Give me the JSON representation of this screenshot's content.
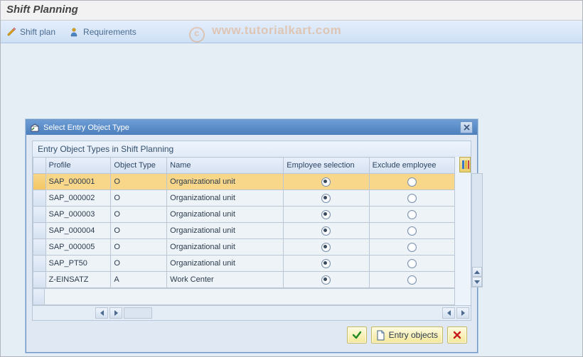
{
  "page": {
    "title": "Shift Planning",
    "watermark": "www.tutorialkart.com"
  },
  "toolbar": {
    "shift_plan": "Shift plan",
    "requirements": "Requirements"
  },
  "dialog": {
    "title": "Select Entry Object Type",
    "group_title": "Entry Object Types in Shift Planning",
    "columns": {
      "profile": "Profile",
      "object_type": "Object Type",
      "name": "Name",
      "employee_selection": "Employee selection",
      "exclude_employee": "Exclude employee"
    },
    "rows": [
      {
        "profile": "SAP_000001",
        "otype": "O",
        "name": "Organizational unit",
        "emp_sel": true,
        "excl": false,
        "selected": true
      },
      {
        "profile": "SAP_000002",
        "otype": "O",
        "name": "Organizational unit",
        "emp_sel": true,
        "excl": false,
        "selected": false
      },
      {
        "profile": "SAP_000003",
        "otype": "O",
        "name": "Organizational unit",
        "emp_sel": true,
        "excl": false,
        "selected": false
      },
      {
        "profile": "SAP_000004",
        "otype": "O",
        "name": "Organizational unit",
        "emp_sel": true,
        "excl": false,
        "selected": false
      },
      {
        "profile": "SAP_000005",
        "otype": "O",
        "name": "Organizational unit",
        "emp_sel": true,
        "excl": false,
        "selected": false
      },
      {
        "profile": "SAP_PT50",
        "otype": "O",
        "name": "Organizational unit",
        "emp_sel": true,
        "excl": false,
        "selected": false
      },
      {
        "profile": "Z-EINSATZ",
        "otype": "A",
        "name": "Work Center",
        "emp_sel": true,
        "excl": false,
        "selected": false
      }
    ],
    "buttons": {
      "entry_objects": "Entry objects"
    }
  },
  "icons": {
    "pencil": "pencil-icon",
    "person": "person-icon",
    "close": "close-icon",
    "config": "config-icon",
    "ok": "ok-icon",
    "new": "new-page-icon",
    "cancel": "cancel-icon"
  }
}
